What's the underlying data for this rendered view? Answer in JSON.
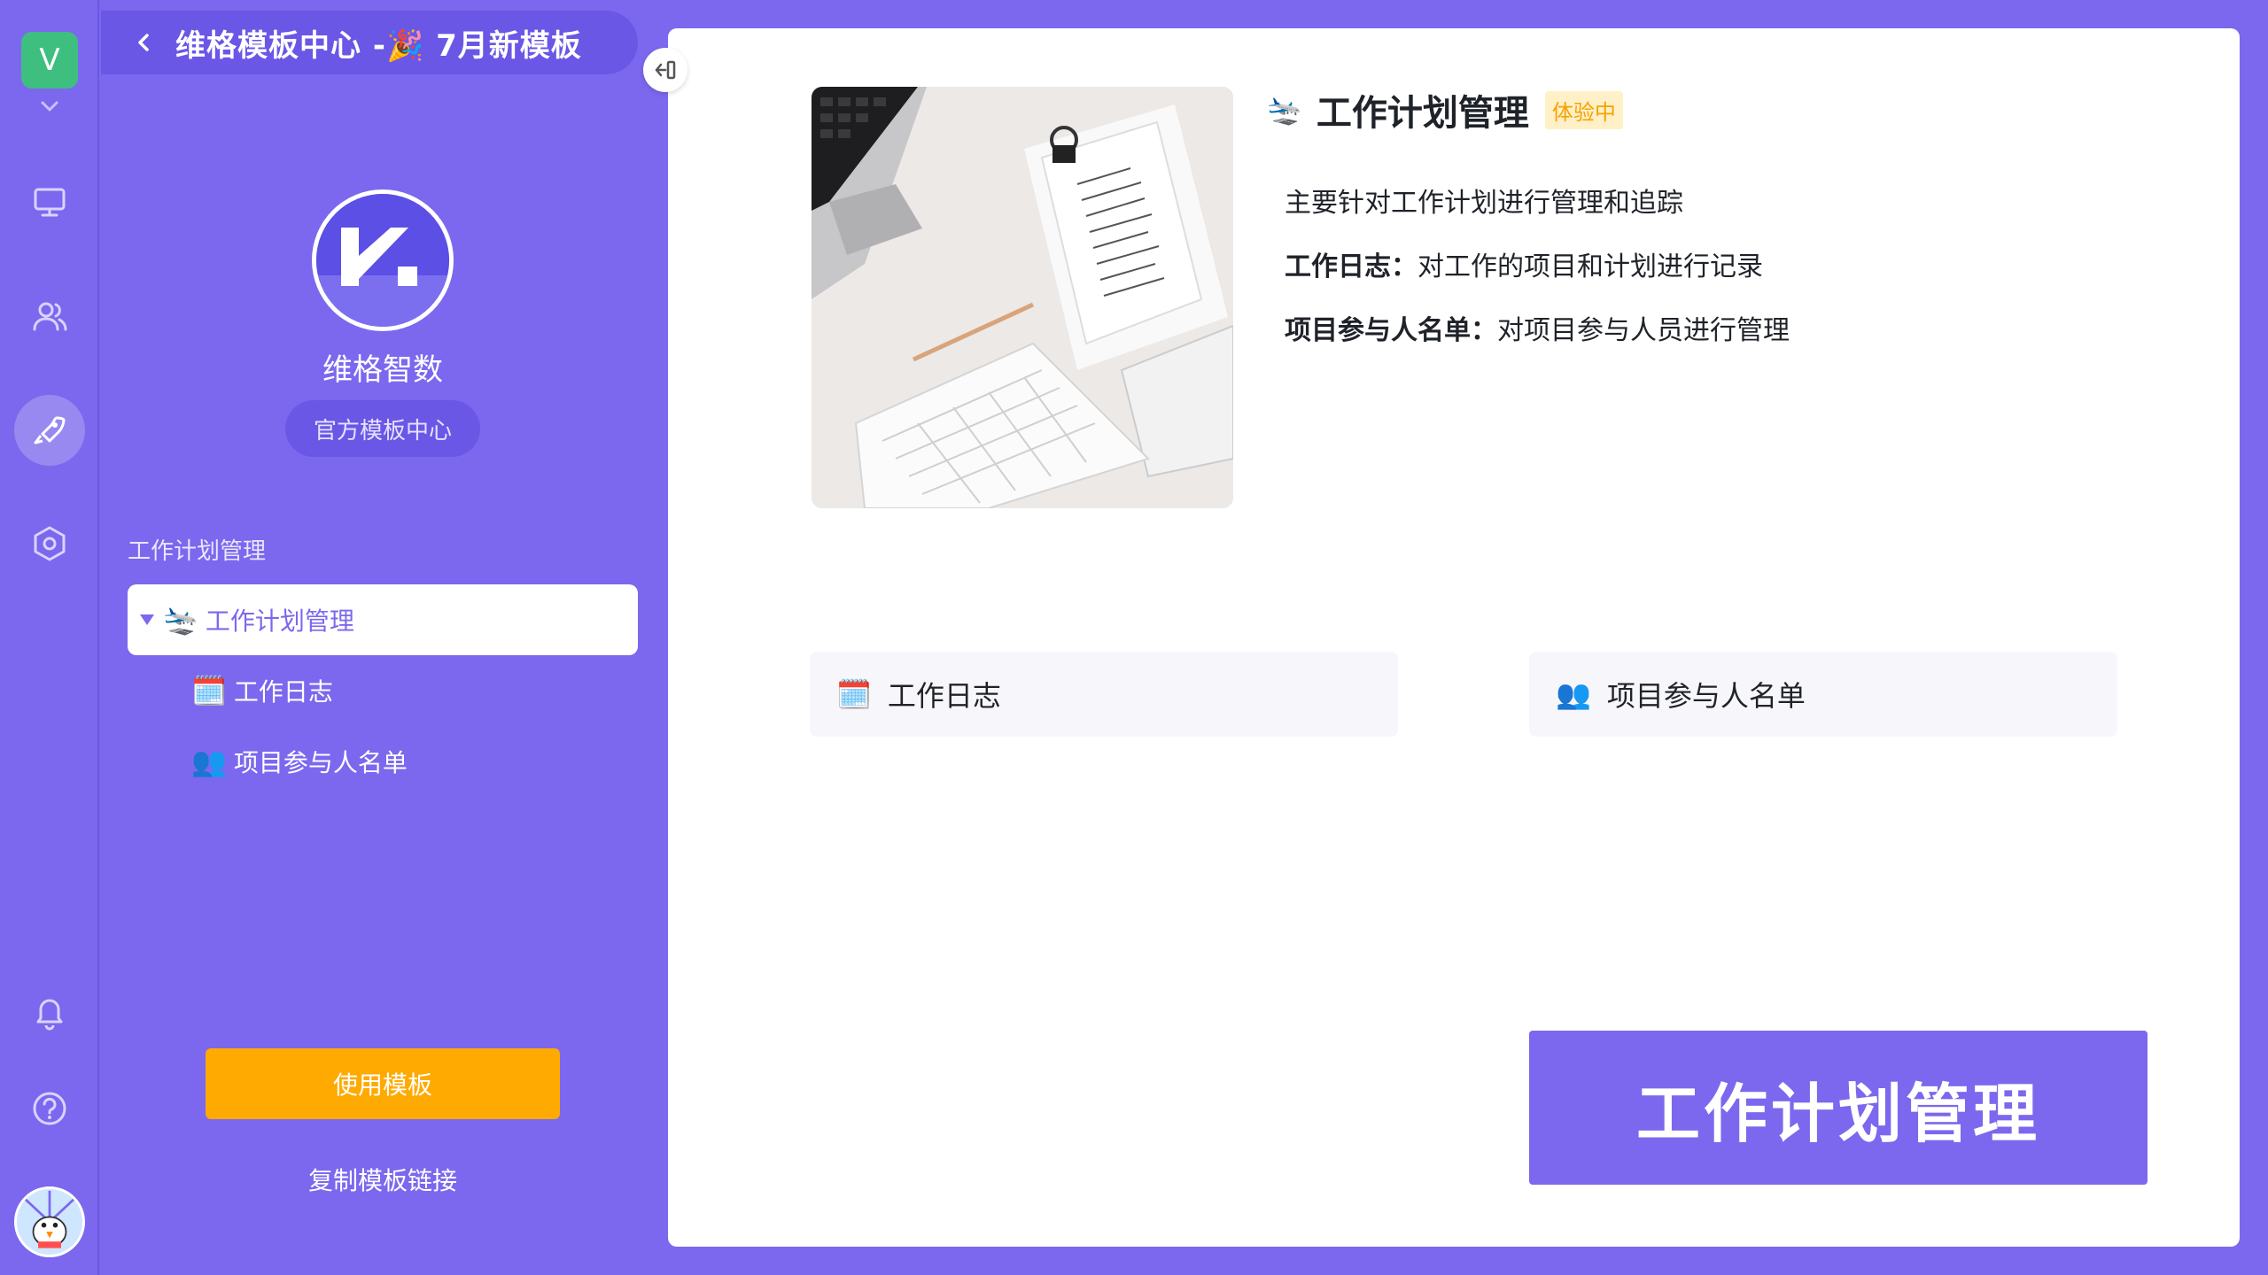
{
  "workspace": {
    "initial": "V"
  },
  "rail": {
    "icons": [
      "monitor-icon",
      "people-icon",
      "rocket-icon",
      "settings-icon",
      "bell-icon",
      "help-icon"
    ],
    "active": "rocket-icon"
  },
  "panel": {
    "breadcrumb": "维格模板中心 -🎉 7月新模板",
    "brand_name": "维格智数",
    "brand_tag": "官方模板中心",
    "section_label": "工作计划管理",
    "tree": [
      {
        "emoji": "🛬",
        "label": "工作计划管理",
        "selected": true
      },
      {
        "emoji": "🗓️",
        "label": "工作日志"
      },
      {
        "emoji": "👥",
        "label": "项目参与人名单"
      }
    ],
    "use_button": "使用模板",
    "copy_link": "复制模板链接"
  },
  "main": {
    "title_emoji": "🛬",
    "title": "工作计划管理",
    "badge": "体验中",
    "summary": "主要针对工作计划进行管理和追踪",
    "details": [
      {
        "key": "工作日志：",
        "text": "对工作的项目和计划进行记录"
      },
      {
        "key": "项目参与人名单：",
        "text": "对项目参与人员进行管理"
      }
    ],
    "sheets": [
      {
        "emoji": "🗓️",
        "label": "工作日志"
      },
      {
        "emoji": "👥",
        "label": "项目参与人名单"
      }
    ],
    "banner": "工作计划管理"
  },
  "colors": {
    "brand": "#7b68ee",
    "accent": "#ffaa00",
    "badge_bg": "#fff0c8",
    "badge_text": "#f5a300"
  }
}
